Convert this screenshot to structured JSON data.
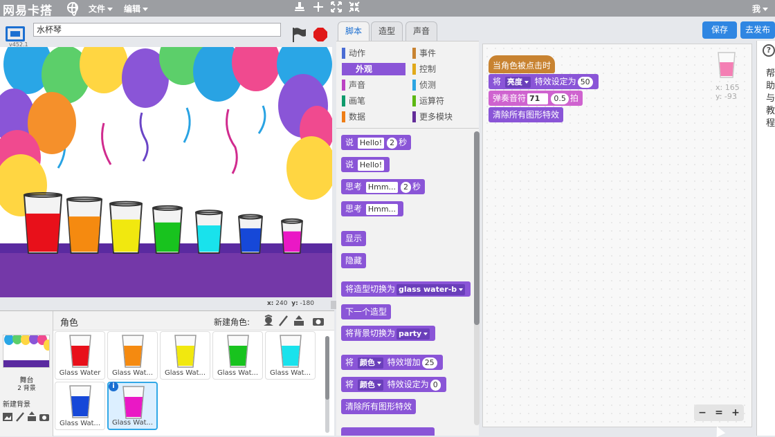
{
  "app": {
    "logo": "网易卡搭",
    "version": "v452.1"
  },
  "menubar": {
    "file": "文件",
    "edit": "编辑",
    "user": "我"
  },
  "icons": {
    "globe": "globe-icon",
    "duplicate": "stamp-icon",
    "delete": "scissors-icon",
    "grow": "grow-icon",
    "shrink": "shrink-icon"
  },
  "project": {
    "title": "水杯琴"
  },
  "stage": {
    "x_label": "x:",
    "x_value": "240",
    "y_label": "y:",
    "y_value": "-180"
  },
  "sprite_pane": {
    "stage_label": "舞台",
    "backdrop_count": "2 背景",
    "new_backdrop": "新建背景",
    "sprites_label": "角色",
    "new_sprite": "新建角色:",
    "sprites": [
      {
        "name": "Glass Water",
        "color": "#e8101a"
      },
      {
        "name": "Glass Wat...",
        "color": "#f58a10"
      },
      {
        "name": "Glass Wat...",
        "color": "#f1e80f"
      },
      {
        "name": "Glass Wat...",
        "color": "#18c31e"
      },
      {
        "name": "Glass Wat...",
        "color": "#19e2ec"
      },
      {
        "name": "Glass Wat...",
        "color": "#1648d8"
      },
      {
        "name": "Glass Wat...",
        "color": "#ea18c5"
      }
    ]
  },
  "tabs": [
    {
      "label": "脚本"
    },
    {
      "label": "造型"
    },
    {
      "label": "声音"
    }
  ],
  "buttons": {
    "save": "保存",
    "publish": "去发布"
  },
  "categories": [
    {
      "label": "动作",
      "color": "#4a6cd4"
    },
    {
      "label": "事件",
      "color": "#c88331"
    },
    {
      "label": "外观",
      "color": "#8a55d7"
    },
    {
      "label": "控制",
      "color": "#e1a91a"
    },
    {
      "label": "声音",
      "color": "#bb42c3"
    },
    {
      "label": "侦测",
      "color": "#2ca5e2"
    },
    {
      "label": "画笔",
      "color": "#0e9a6c"
    },
    {
      "label": "运算符",
      "color": "#5cb712"
    },
    {
      "label": "数据",
      "color": "#ee7d16"
    },
    {
      "label": "更多模块",
      "color": "#632d99"
    }
  ],
  "palette": {
    "say_for": {
      "a": "说",
      "msg": "Hello!",
      "secs": "2",
      "b": "秒"
    },
    "say": {
      "a": "说",
      "msg": "Hello!"
    },
    "think_for": {
      "a": "思考",
      "msg": "Hmm...",
      "secs": "2",
      "b": "秒"
    },
    "think": {
      "a": "思考",
      "msg": "Hmm..."
    },
    "show": "显示",
    "hide": "隐藏",
    "switch_costume": {
      "a": "将造型切换为",
      "val": "glass water-b"
    },
    "next_costume": "下一个造型",
    "switch_backdrop": {
      "a": "将背景切换为",
      "val": "party"
    },
    "change_effect": {
      "a": "将",
      "effect": "颜色",
      "b": "特效增加",
      "val": "25"
    },
    "set_effect": {
      "a": "将",
      "effect": "颜色",
      "b": "特效设定为",
      "val": "0"
    },
    "clear_effects": "清除所有图形特效"
  },
  "script": {
    "hat": "当角色被点击时",
    "set_effect": {
      "a": "将",
      "effect": "亮度",
      "b": "特效设定为",
      "val": "50"
    },
    "play_note": {
      "a": "弹奏音符",
      "note": "71",
      "beats": "0.5",
      "b": "拍"
    },
    "clear": "清除所有图形特效"
  },
  "sprite_info": {
    "x_label": "x:",
    "x": "165",
    "y_label": "y:",
    "y": "-93",
    "color": "#f47fb4"
  },
  "zoom": {
    "out": "−",
    "reset": "=",
    "in": "+"
  },
  "help": {
    "text": "帮助与教程"
  }
}
